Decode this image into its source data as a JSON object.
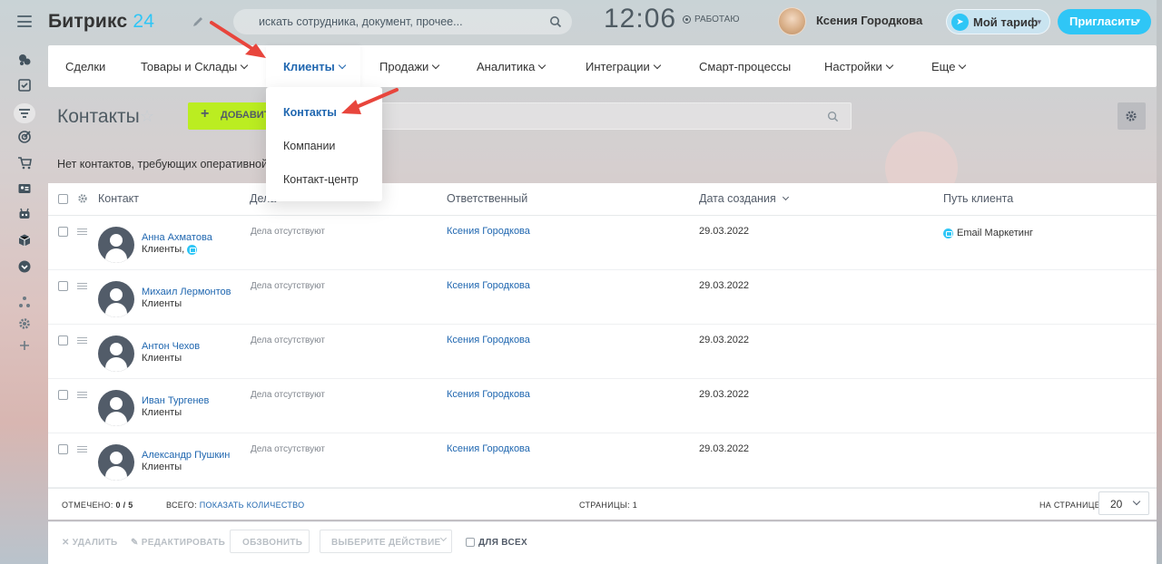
{
  "header": {
    "logo_text": "Битрикс",
    "logo_num": "24",
    "search_placeholder": "искать сотрудника, документ, прочее...",
    "clock": "12:06",
    "work_status": "РАБОТАЮ",
    "user_name": "Ксения Городкова",
    "tariff_label": "Мой тариф",
    "invite_label": "Пригласить"
  },
  "top_menu": {
    "items": [
      {
        "label": "Сделки"
      },
      {
        "label": "Товары и Склады"
      },
      {
        "label": "Клиенты"
      },
      {
        "label": "Продажи"
      },
      {
        "label": "Аналитика"
      },
      {
        "label": "Интеграции"
      },
      {
        "label": "Смарт-процессы"
      },
      {
        "label": "Настройки"
      },
      {
        "label": "Еще"
      }
    ],
    "active": "Клиенты"
  },
  "dropdown": {
    "items": [
      {
        "label": "Контакты"
      },
      {
        "label": "Компании"
      },
      {
        "label": "Контакт-центр"
      }
    ],
    "active": "Контакты"
  },
  "page": {
    "title": "Контакты",
    "add_button": "ДОБАВИТЬ",
    "notice": "Нет контактов, требующих оперативной р"
  },
  "grid": {
    "columns": [
      "Контакт",
      "Дела",
      "Ответственный",
      "Дата создания",
      "Путь клиента"
    ],
    "rows": [
      {
        "name": "Анна Ахматова",
        "type": "Клиенты,",
        "deals": "Дела отсутствуют",
        "responsible": "Ксения Городкова",
        "created": "29.03.2022",
        "path": "Email Маркетинг"
      },
      {
        "name": "Михаил Лермонтов",
        "type": "Клиенты",
        "deals": "Дела отсутствуют",
        "responsible": "Ксения Городкова",
        "created": "29.03.2022",
        "path": ""
      },
      {
        "name": "Антон Чехов",
        "type": "Клиенты",
        "deals": "Дела отсутствуют",
        "responsible": "Ксения Городкова",
        "created": "29.03.2022",
        "path": ""
      },
      {
        "name": "Иван Тургенев",
        "type": "Клиенты",
        "deals": "Дела отсутствуют",
        "responsible": "Ксения Городкова",
        "created": "29.03.2022",
        "path": ""
      },
      {
        "name": "Александр Пушкин",
        "type": "Клиенты",
        "deals": "Дела отсутствуют",
        "responsible": "Ксения Городкова",
        "created": "29.03.2022",
        "path": ""
      }
    ],
    "footer": {
      "selected_label": "ОТМЕЧЕНО:",
      "selected_value": "0 / 5",
      "total_label": "ВСЕГО:",
      "total_link": "ПОКАЗАТЬ КОЛИЧЕСТВО",
      "pages_label": "СТРАНИЦЫ:",
      "pages_value": "1",
      "per_page_label": "НА СТРАНИЦЕ:",
      "per_page_value": "20"
    }
  },
  "actions": {
    "delete": "УДАЛИТЬ",
    "edit": "РЕДАКТИРОВАТЬ",
    "call": "ОБЗВОНИТЬ",
    "choose": "ВЫБЕРИТЕ ДЕЙСТВИЕ",
    "for_all": "ДЛЯ ВСЕХ"
  },
  "colors": {
    "accent": "#2fc6f6",
    "link": "#2067b0",
    "add_button": "#bbed21",
    "annotation_arrow": "#e8453c"
  },
  "icons": [
    "hamburger-icon",
    "pencil-icon",
    "search-icon",
    "star-icon",
    "gear-icon",
    "rocket-icon",
    "user-avatar-icon",
    "arrow-annotation"
  ]
}
